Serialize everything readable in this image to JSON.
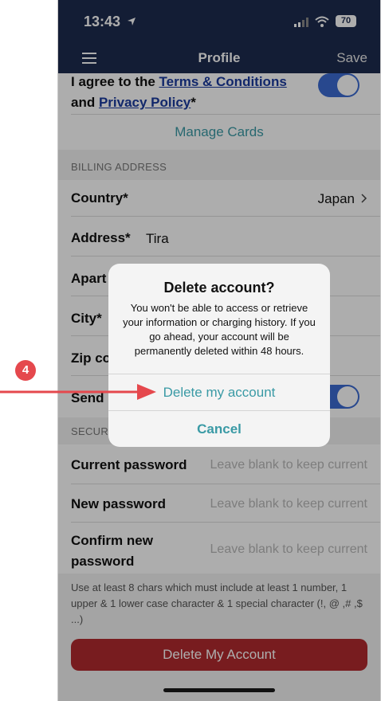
{
  "status": {
    "time": "13:43",
    "battery": "70"
  },
  "nav": {
    "title": "Profile",
    "save_label": "Save"
  },
  "terms": {
    "prefix": "I agree to the ",
    "terms_link": "Terms & Conditions",
    "mid": "and ",
    "privacy_link": "Privacy Policy",
    "suffix": "*"
  },
  "manage_cards": "Manage Cards",
  "billing": {
    "header": "BILLING ADDRESS",
    "country_label": "Country*",
    "country_value": "Japan",
    "address_label": "Address*",
    "address_value": "Tira",
    "apartment_label": "Apart",
    "city_label": "City*",
    "zip_label": "Zip co",
    "send_label": "Send"
  },
  "security": {
    "header": "SECUR",
    "current_label": "Current password",
    "new_label": "New password",
    "confirm_label_1": "Confirm new",
    "confirm_label_2": "password",
    "placeholder": "Leave blank to keep current",
    "hint": "Use at least 8 chars which must include at least 1 number, 1 upper & 1 lower case character & 1 special character (!, @ ,# ,$ ...)"
  },
  "delete_button": "Delete My Account",
  "dialog": {
    "title": "Delete account?",
    "message": "You won't be able to access or retrieve your information or charging history. If you go ahead, your account will be permanently deleted within 48 hours.",
    "confirm": "Delete my account",
    "cancel": "Cancel"
  },
  "annotation": {
    "step": "4"
  },
  "colors": {
    "navy": "#1d2b4f",
    "accent": "#3a9aa5",
    "danger": "#b22a2e",
    "arrow": "#e5484d"
  }
}
